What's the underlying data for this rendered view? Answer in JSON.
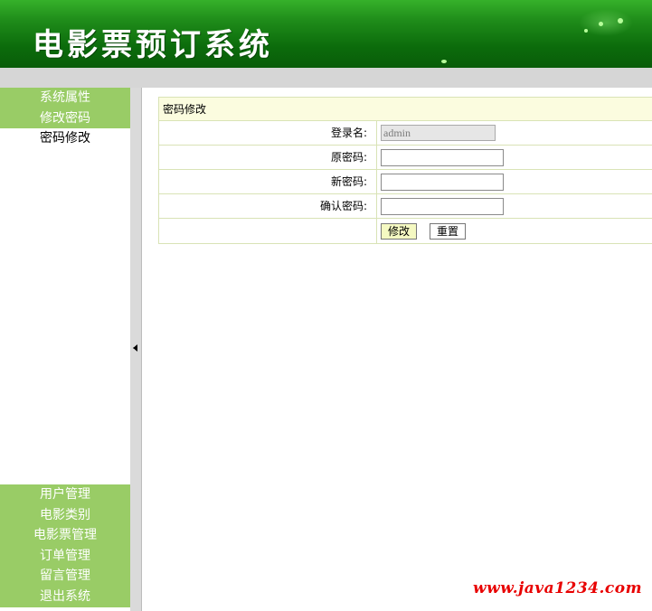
{
  "header": {
    "title": "电影票预订系统"
  },
  "sidebar": {
    "top_items": [
      {
        "label": "系统属性",
        "active": false
      },
      {
        "label": "修改密码",
        "active": false
      },
      {
        "label": "密码修改",
        "active": true
      }
    ],
    "bottom_items": [
      {
        "label": "用户管理"
      },
      {
        "label": "电影类别"
      },
      {
        "label": "电影票管理"
      },
      {
        "label": "订单管理"
      },
      {
        "label": "留言管理"
      },
      {
        "label": "退出系统"
      }
    ]
  },
  "form": {
    "caption": "密码修改",
    "username_label": "登录名:",
    "username_value": "admin",
    "old_password_label": "原密码:",
    "new_password_label": "新密码:",
    "confirm_password_label": "确认密码:",
    "submit_label": "修改",
    "reset_label": "重置"
  },
  "watermark": "www.java1234.com",
  "colors": {
    "banner": "#1f8c1a",
    "nav_bg": "#99cc66",
    "form_border": "#d9e3b6",
    "caption_bg": "#fbfcdf",
    "submit_bg": "#f5f9c2",
    "watermark": "#e80000"
  }
}
